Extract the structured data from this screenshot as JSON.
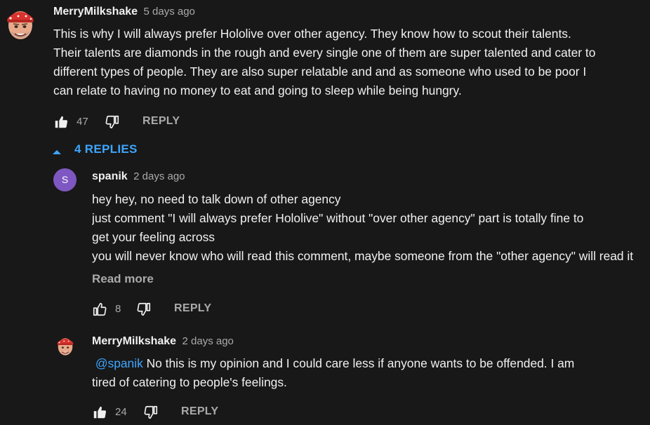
{
  "comment": {
    "author": "MerryMilkshake",
    "time": "5 days ago",
    "lines": [
      "This is why I will always prefer Hololive over other agency. They know how to scout their talents.",
      "Their talents are diamonds in the rough and every single one of them are super talented and cater to",
      "different types of people. They are also super relatable and and as someone who used to be poor I",
      "can relate to having no money to eat and going to sleep while being hungry."
    ],
    "likes": "47",
    "reply_label": "REPLY"
  },
  "replies_toggle": {
    "label": "4 REPLIES"
  },
  "replies": [
    {
      "author": "spanik",
      "avatar_letter": "S",
      "avatar_color": "#7e57c2",
      "time": "2 days ago",
      "lines": [
        "hey hey,  no need to talk down of other agency",
        "just comment \"I will always prefer Hololive\" without \"over other agency\" part is totally fine to",
        "get your feeling across",
        "you will never know who will read this comment, maybe someone from the \"other agency\" will read it"
      ],
      "read_more": "Read more",
      "likes": "8",
      "reply_label": "REPLY"
    },
    {
      "author": "MerryMilkshake",
      "time": "2 days ago",
      "mention": "@spanik",
      "line1_rest": "  No this is my opinion and I could care less if anyone wants to be offended. I am",
      "line2": "tired of catering to people's feelings.",
      "likes": "24",
      "reply_label": "REPLY"
    }
  ],
  "colors": {
    "background": "#181818",
    "text": "#f1f1f1",
    "secondary": "#aaaaaa",
    "link": "#3ea6ff"
  }
}
